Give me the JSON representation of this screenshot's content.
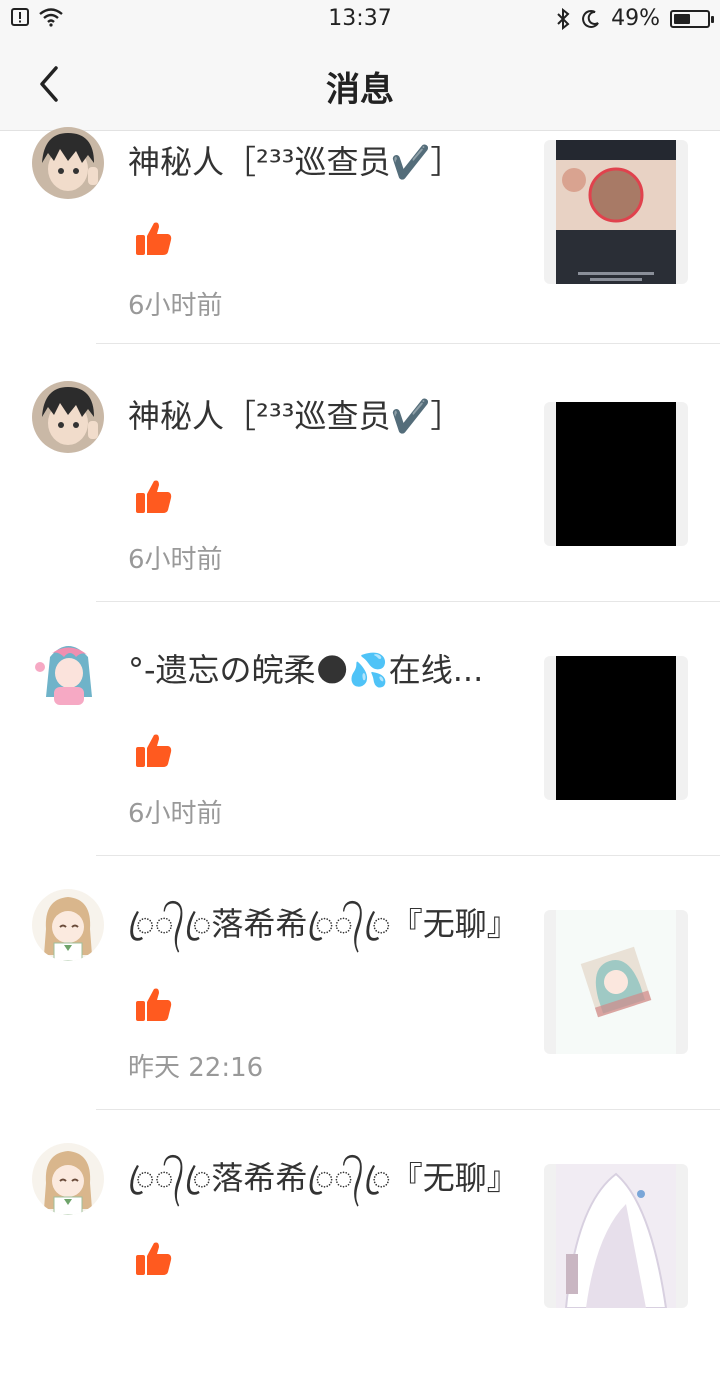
{
  "status": {
    "time": "13:37",
    "battery": "49%",
    "battery_level": 0.49
  },
  "nav": {
    "title": "消息"
  },
  "messages": [
    {
      "name": "神秘人［²³³巡查员✔️］",
      "time": "6小时前"
    },
    {
      "name": "神秘人［²³³巡查员✔️］",
      "time": "6小时前"
    },
    {
      "name": "°-遗忘の皖柔🌑💦在线...",
      "time": "6小时前"
    },
    {
      "name": "ꦿ᭄ꦿ落希希ꦿ᭄ꦿ『无聊』",
      "time": "昨天 22:16"
    },
    {
      "name": "ꦿ᭄ꦿ落希希ꦿ᭄ꦿ『无聊』",
      "time": ""
    }
  ],
  "colors": {
    "accent": "#ff5a1f",
    "bar_bg": "#f7f7f7",
    "meta_text": "#999999"
  },
  "icons": {
    "back": "chevron-left-icon",
    "like": "thumbs-up-icon",
    "wifi": "wifi-icon",
    "bluetooth": "bluetooth-icon",
    "moon": "moon-icon"
  }
}
